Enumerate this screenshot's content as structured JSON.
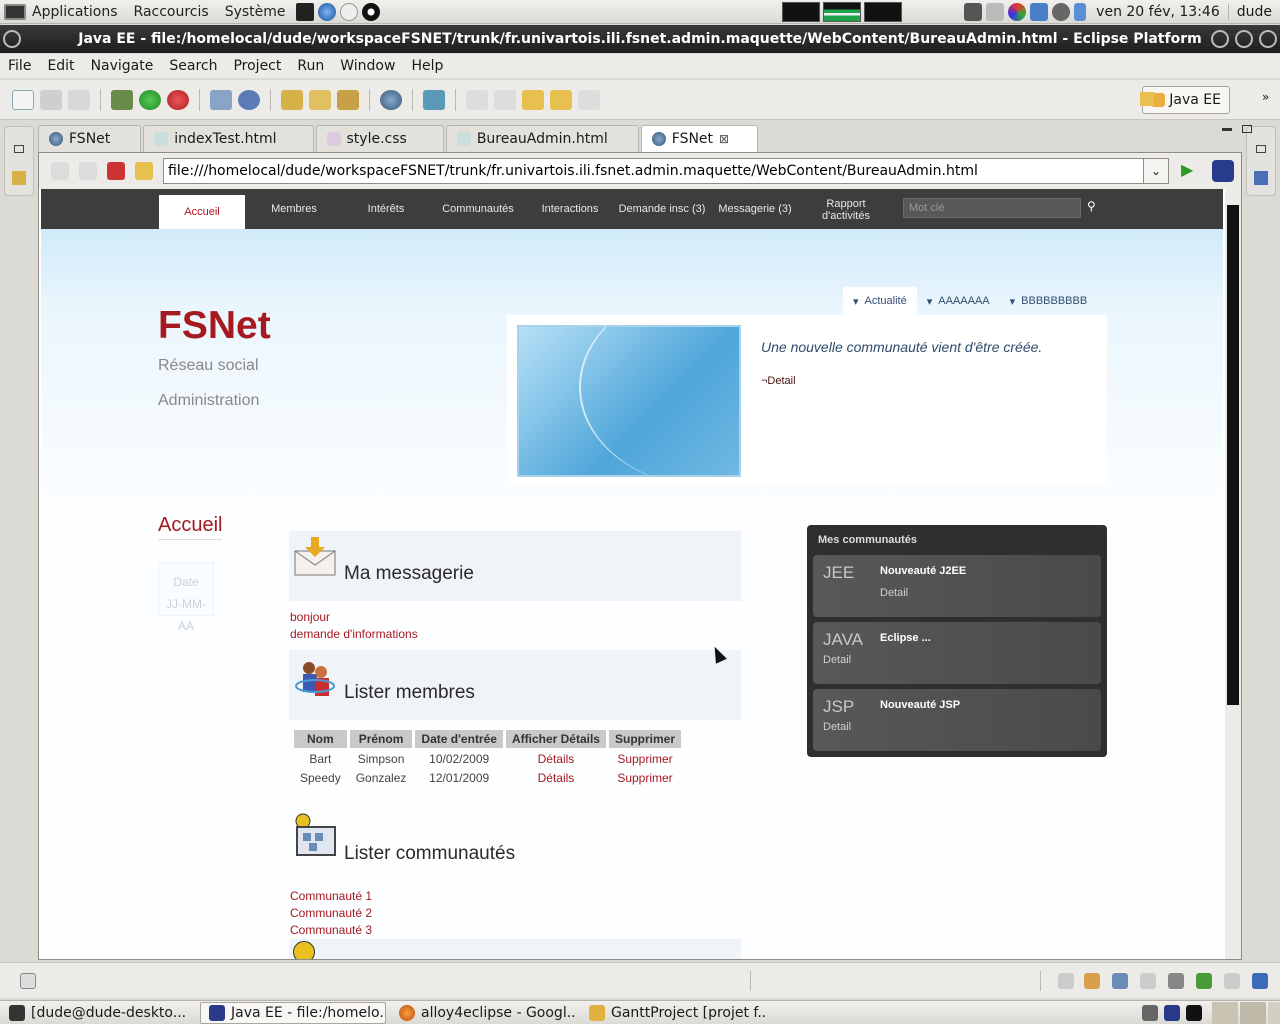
{
  "top_panel": {
    "menus": [
      "Applications",
      "Raccourcis",
      "Système"
    ],
    "clock": "ven 20 fév, 13:46",
    "user": "dude"
  },
  "window": {
    "title": "Java EE - file:/homelocal/dude/workspaceFSNET/trunk/fr.univartois.ili.fsnet.admin.maquette/WebContent/BureauAdmin.html - Eclipse Platform"
  },
  "menu_bar": {
    "items": [
      "File",
      "Edit",
      "Navigate",
      "Search",
      "Project",
      "Run",
      "Window",
      "Help"
    ]
  },
  "toolbar": {
    "perspective": "Java EE"
  },
  "tabs": [
    {
      "label": "FSNet"
    },
    {
      "label": "indexTest.html"
    },
    {
      "label": "style.css"
    },
    {
      "label": "BureauAdmin.html"
    },
    {
      "label": "FSNet"
    }
  ],
  "browser": {
    "url": "file:///homelocal/dude/workspaceFSNET/trunk/fr.univartois.ili.fsnet.admin.maquette/WebContent/BureauAdmin.html"
  },
  "site": {
    "nav": [
      "Accueil",
      "Membres",
      "Intérêts",
      "Communautés",
      "Interactions",
      "Demande insc (3)",
      "Messagerie (3)",
      "Rapport d'activités"
    ],
    "search_placeholder": "Mot clé",
    "brand": "FSNet",
    "brand_sub1": "Réseau social",
    "brand_sub2": "Administration",
    "news_tabs": [
      "Actualité",
      "AAAAAAA",
      "BBBBBBBBB"
    ],
    "news_text": "Une nouvelle communauté vient d'être créée.",
    "news_link": "¬Detail",
    "sidebar_title": "Accueil",
    "date_label": "Date",
    "date_value": "JJ-MM-AA",
    "messagerie": {
      "title": "Ma messagerie",
      "items": [
        "bonjour",
        "demande d'informations"
      ]
    },
    "membres": {
      "title": "Lister membres",
      "headers": [
        "Nom",
        "Prénom",
        "Date d'entrée",
        "Afficher Détails",
        "Supprimer"
      ],
      "rows": [
        [
          "Bart",
          "Simpson",
          "10/02/2009",
          "Détails",
          "Supprimer"
        ],
        [
          "Speedy",
          "Gonzalez",
          "12/01/2009",
          "Détails",
          "Supprimer"
        ]
      ]
    },
    "communautes": {
      "title": "Lister communautés",
      "items": [
        "Communauté 1",
        "Communauté 2",
        "Communauté 3"
      ]
    },
    "mes_communautes": {
      "title": "Mes communautés",
      "cards": [
        {
          "abbr": "JEE",
          "name": "Nouveauté J2EE",
          "detail": "Detail"
        },
        {
          "abbr": "JAVA",
          "name": "Eclipse ...",
          "detail": "Detail"
        },
        {
          "abbr": "JSP",
          "name": "Nouveauté JSP",
          "detail": "Detail"
        }
      ]
    }
  },
  "taskbar": {
    "items": [
      "[dude@dude-deskto...",
      "Java EE - file:/homelo...",
      "alloy4eclipse - Googl...",
      "GanttProject [projet f..."
    ]
  }
}
